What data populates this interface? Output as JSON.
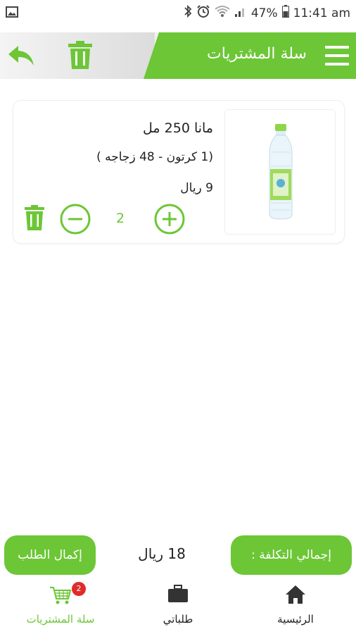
{
  "status_bar": {
    "battery": "47%",
    "time": "11:41 am"
  },
  "header": {
    "title": "سلة المشتريات"
  },
  "cart_item": {
    "name": "مانا 250 مل",
    "pack": "(1 كرتون  -  48 زجاجه )",
    "price": "9 ريال",
    "quantity": "2"
  },
  "summary": {
    "total_label": "إجمالي التكلفة :",
    "total_value": "18 ريال",
    "checkout_label": "إكمال الطلب"
  },
  "bottom_nav": {
    "home_label": "الرئيسية",
    "orders_label": "طلباتي",
    "cart_label": "سلة المشتريات",
    "cart_badge": "2"
  },
  "colors": {
    "accent": "#6cc636",
    "badge": "#e12b2b"
  }
}
